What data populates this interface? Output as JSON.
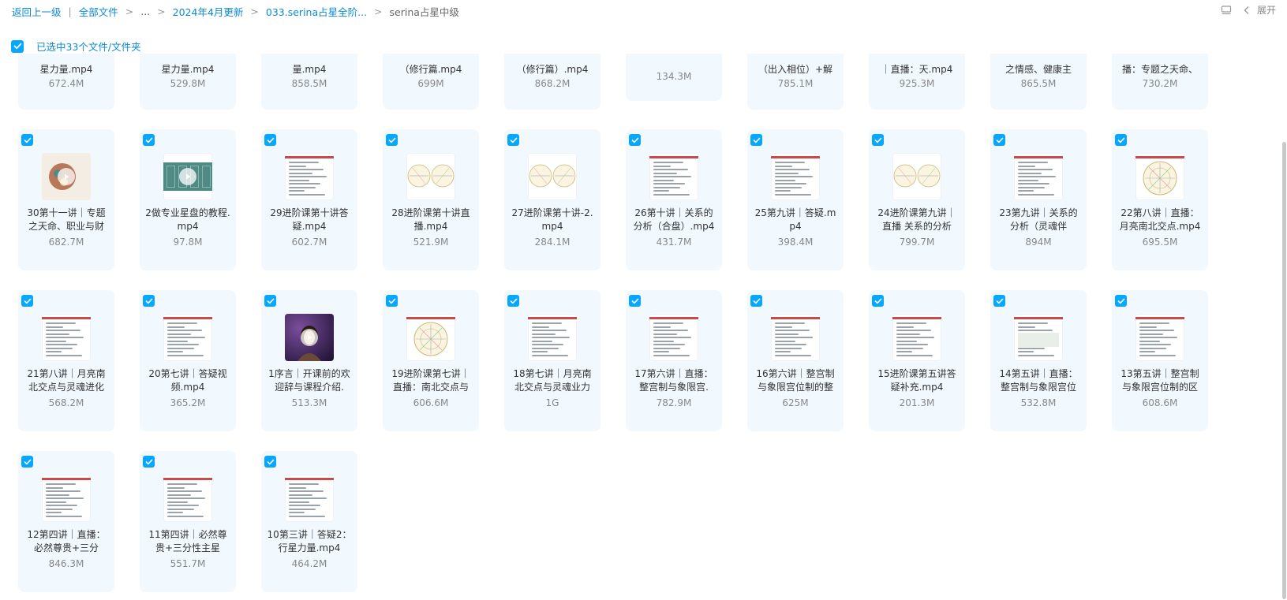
{
  "breadcrumb": {
    "back": "返回上一级",
    "root": "全部文件",
    "ellipsis": "...",
    "level1": "2024年4月更新",
    "level2": "033.serina占星全阶...",
    "current": "serina占星中级",
    "separator_pipe": "|",
    "separator_arrow": ">"
  },
  "toolbar": {
    "expand_label": "展开",
    "list_icon": "list-view-icon",
    "collapse_icon": "chevron-left-icon"
  },
  "selection": {
    "label": "已选中33个文件/文件夹",
    "checked": true
  },
  "colors": {
    "accent": "#06a7ff",
    "link": "#0a8ad6",
    "card_bg": "#f1f8fe"
  },
  "files": {
    "row0": [
      {
        "name": "星力量.mp4",
        "size": "672.4M"
      },
      {
        "name": "星力量.mp4",
        "size": "529.8M"
      },
      {
        "name": "量.mp4",
        "size": "858.5M"
      },
      {
        "name": "（修行篇.mp4",
        "size": "699M"
      },
      {
        "name": "（修行篇）.mp4",
        "size": "868.2M"
      },
      {
        "name": "",
        "size": "134.3M"
      },
      {
        "name": "（出入相位）+解",
        "size": "785.1M"
      },
      {
        "name": "｜直播：天.mp4",
        "size": "925.3M"
      },
      {
        "name": "之情感、健康主",
        "size": "865.5M"
      },
      {
        "name": "播：专题之天命、",
        "size": "730.2M"
      }
    ],
    "row1": [
      {
        "name": "30第十一讲｜专题之天命、职业与财",
        "size": "682.7M",
        "thumb": "astro-photo"
      },
      {
        "name": "2做专业星盘的教程.mp4",
        "size": "97.8M",
        "thumb": "teal"
      },
      {
        "name": "29进阶课第十讲答疑.mp4",
        "size": "602.7M",
        "thumb": "doc"
      },
      {
        "name": "28进阶课第十讲直播.mp4",
        "size": "521.9M",
        "thumb": "chart2"
      },
      {
        "name": "27进阶课第十讲-2.mp4",
        "size": "284.1M",
        "thumb": "chart2"
      },
      {
        "name": "26第十讲｜关系的分析（合盘）.mp4",
        "size": "431.7M",
        "thumb": "doc"
      },
      {
        "name": "25第九讲｜答疑.mp4",
        "size": "398.4M",
        "thumb": "doc"
      },
      {
        "name": "24进阶课第九讲｜直播 关系的分析",
        "size": "799.7M",
        "thumb": "chart2"
      },
      {
        "name": "23第九讲｜关系的分析（灵魂伴",
        "size": "894M",
        "thumb": "doc"
      },
      {
        "name": "22第八讲｜直播：月亮南北交点.mp4",
        "size": "695.5M",
        "thumb": "chart1"
      }
    ],
    "row2": [
      {
        "name": "21第八讲｜月亮南北交点与灵魂进化",
        "size": "568.2M",
        "thumb": "doc"
      },
      {
        "name": "20第七讲｜答疑视频.mp4",
        "size": "365.2M",
        "thumb": "doc"
      },
      {
        "name": "1序言｜开课前的欢迎辞与课程介绍.",
        "size": "513.3M",
        "thumb": "person"
      },
      {
        "name": "19进阶课第七讲｜直播：南北交点与",
        "size": "606.6M",
        "thumb": "chart1"
      },
      {
        "name": "18第七讲｜月亮南北交点与灵魂业力",
        "size": "1G",
        "thumb": "doc"
      },
      {
        "name": "17第六讲｜直播：整宫制与象限宫.",
        "size": "782.9M",
        "thumb": "doc"
      },
      {
        "name": "16第六讲｜整宫制与象限宫位制的整",
        "size": "625M",
        "thumb": "doc"
      },
      {
        "name": "15进阶课第五讲答疑补充.mp4",
        "size": "201.3M",
        "thumb": "doc"
      },
      {
        "name": "14第五讲｜直播：整宫制与象限宫位",
        "size": "532.8M",
        "thumb": "green"
      },
      {
        "name": "13第五讲｜整宫制与象限宫位制的区",
        "size": "608.6M",
        "thumb": "doc"
      }
    ],
    "row3": [
      {
        "name": "12第四讲｜直播：必然尊贵+三分",
        "size": "846.3M",
        "thumb": "doc"
      },
      {
        "name": "11第四讲｜必然尊贵+三分性主星",
        "size": "551.7M",
        "thumb": "doc"
      },
      {
        "name": "10第三讲｜答疑2：行星力量.mp4",
        "size": "464.2M",
        "thumb": "doc"
      }
    ]
  }
}
